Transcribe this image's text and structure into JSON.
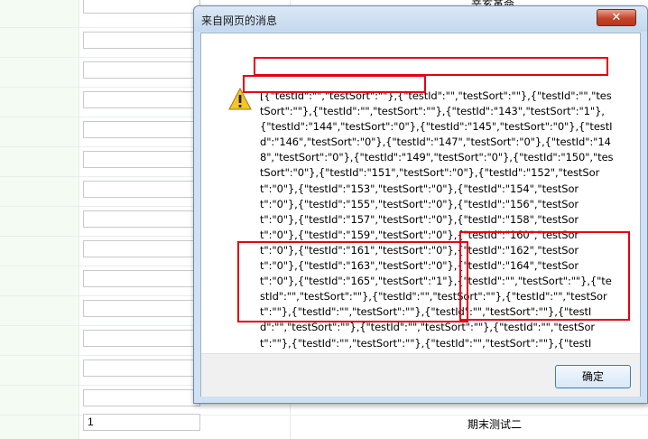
{
  "background": {
    "rows": [
      {
        "input_value": "",
        "right_text": "辛亥革命"
      },
      {
        "input_value": "",
        "right_text": ""
      },
      {
        "input_value": "",
        "right_text": ""
      },
      {
        "input_value": "",
        "right_text": ""
      },
      {
        "input_value": "",
        "right_text": ""
      },
      {
        "input_value": "",
        "right_text": ""
      },
      {
        "input_value": "",
        "right_text": ""
      },
      {
        "input_value": "",
        "right_text": ""
      },
      {
        "input_value": "",
        "right_text": ""
      },
      {
        "input_value": "",
        "right_text": ""
      },
      {
        "input_value": "",
        "right_text": ""
      },
      {
        "input_value": "",
        "right_text": ""
      },
      {
        "input_value": "",
        "right_text": ""
      },
      {
        "input_value": "",
        "right_text": ""
      },
      {
        "input_value": "1",
        "right_text": "期末测试二"
      }
    ]
  },
  "dialog": {
    "title": "来自网页的消息",
    "close_symbol": "✕",
    "icon": "warning-icon",
    "message": "[{\"testId\":\"\",\"testSort\":\"\"},{\"testId\":\"\",\"testSort\":\"\"},{\"testId\":\"\",\"testSort\":\"\"},{\"testId\":\"\",\"testSort\":\"\"},{\"testId\":\"143\",\"testSort\":\"1\"},{\"testId\":\"144\",\"testSort\":\"0\"},{\"testId\":\"145\",\"testSort\":\"0\"},{\"testId\":\"146\",\"testSort\":\"0\"},{\"testId\":\"147\",\"testSort\":\"0\"},{\"testId\":\"148\",\"testSort\":\"0\"},{\"testId\":\"149\",\"testSort\":\"0\"},{\"testId\":\"150\",\"testSort\":\"0\"},{\"testId\":\"151\",\"testSort\":\"0\"},{\"testId\":\"152\",\"testSort\":\"0\"},{\"testId\":\"153\",\"testSort\":\"0\"},{\"testId\":\"154\",\"testSort\":\"0\"},{\"testId\":\"155\",\"testSort\":\"0\"},{\"testId\":\"156\",\"testSort\":\"0\"},{\"testId\":\"157\",\"testSort\":\"0\"},{\"testId\":\"158\",\"testSort\":\"0\"},{\"testId\":\"159\",\"testSort\":\"0\"},{\"testId\":\"160\",\"testSort\":\"0\"},{\"testId\":\"161\",\"testSort\":\"0\"},{\"testId\":\"162\",\"testSort\":\"0\"},{\"testId\":\"163\",\"testSort\":\"0\"},{\"testId\":\"164\",\"testSort\":\"0\"},{\"testId\":\"165\",\"testSort\":\"1\"},{\"testId\":\"\",\"testSort\":\"\"},{\"testId\":\"\",\"testSort\":\"\"},{\"testId\":\"\",\"testSort\":\"\"},{\"testId\":\"\",\"testSort\":\"\"},{\"testId\":\"\",\"testSort\":\"\"},{\"testId\":\"\",\"testSort\":\"\"},{\"testId\":\"\",\"testSort\":\"\"},{\"testId\":\"\",\"testSort\":\"\"},{\"testId\":\"\",\"testSort\":\"\"},{\"testId\":\"\",\"testSort\":\"\"},{\"testId\":\"\",\"testSort\":\"\"},{\"testId\":\"\",\"testSort\":\"\"},{\"testId\":\"\",\"testSort\":\"\"},{\"testId\":\"\",\"testSort\":\"\"},{\"testId\":\"\",\"testSort\":\"\"},{\"testId\":\"\",\"testSort\":\"\"},",
    "ok_label": "确定"
  },
  "colors": {
    "highlight": "#e60012",
    "dialog_frame": "#cfe1f3",
    "close_button": "#c2452a"
  }
}
